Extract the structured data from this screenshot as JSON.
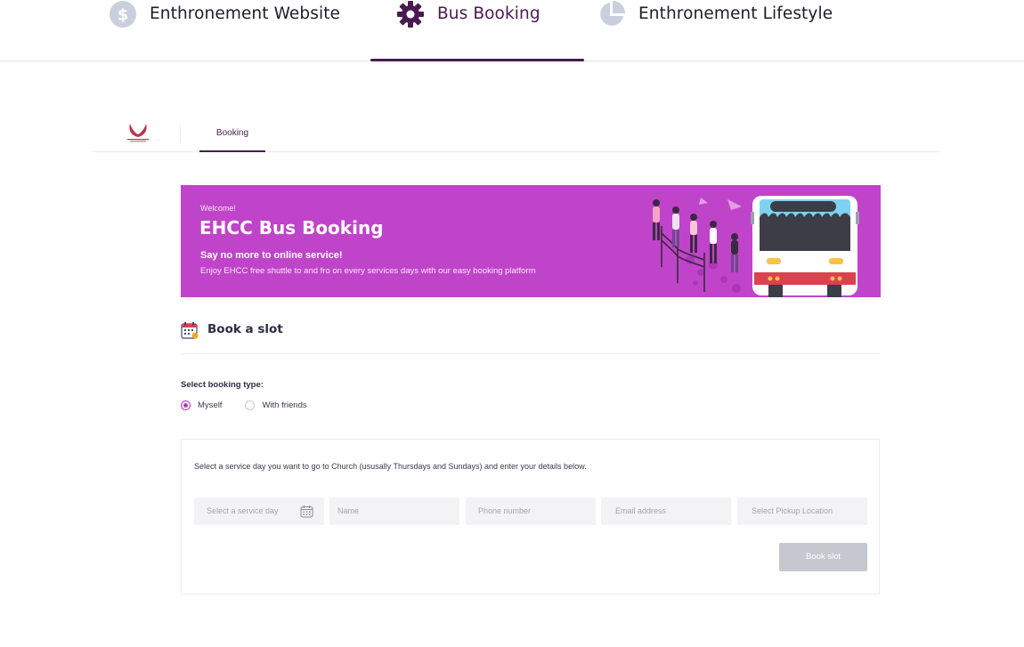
{
  "top_tabs": [
    {
      "label": "Enthronement Website",
      "icon": "dollar-circle-icon"
    },
    {
      "label": "Bus Booking",
      "icon": "gear-icon",
      "active": true
    },
    {
      "label": "Enthronement Lifestyle",
      "icon": "pie-chart-icon"
    }
  ],
  "subnav": {
    "logo": "enthronement-logo",
    "tabs": [
      {
        "label": "Booking",
        "active": true
      }
    ]
  },
  "banner": {
    "welcome": "Welcome!",
    "title": "EHCC Bus Booking",
    "subtitle": "Say no more to online service!",
    "description": "Enjoy EHCC free shuttle to and fro on every services days with our easy booking platform",
    "background": "#c044c9"
  },
  "slot": {
    "title": "Book a slot",
    "icon": "calendar-icon"
  },
  "booking_type": {
    "label": "Select booking type:",
    "options": [
      {
        "label": "Myself",
        "selected": true
      },
      {
        "label": "With friends",
        "selected": false
      }
    ]
  },
  "form": {
    "instruction": "Select a service day you want to go to Church (ususally Thursdays and Sundays) and enter your details below.",
    "fields": {
      "service_day": "Select a service day",
      "name": "Name",
      "phone": "Phone number",
      "email": "Email address",
      "pickup": "Select Pickup Location"
    },
    "submit_label": "Book slot"
  },
  "colors": {
    "accent": "#4a1a52",
    "radio": "#b03cba",
    "button_disabled": "#c7c7cf"
  }
}
